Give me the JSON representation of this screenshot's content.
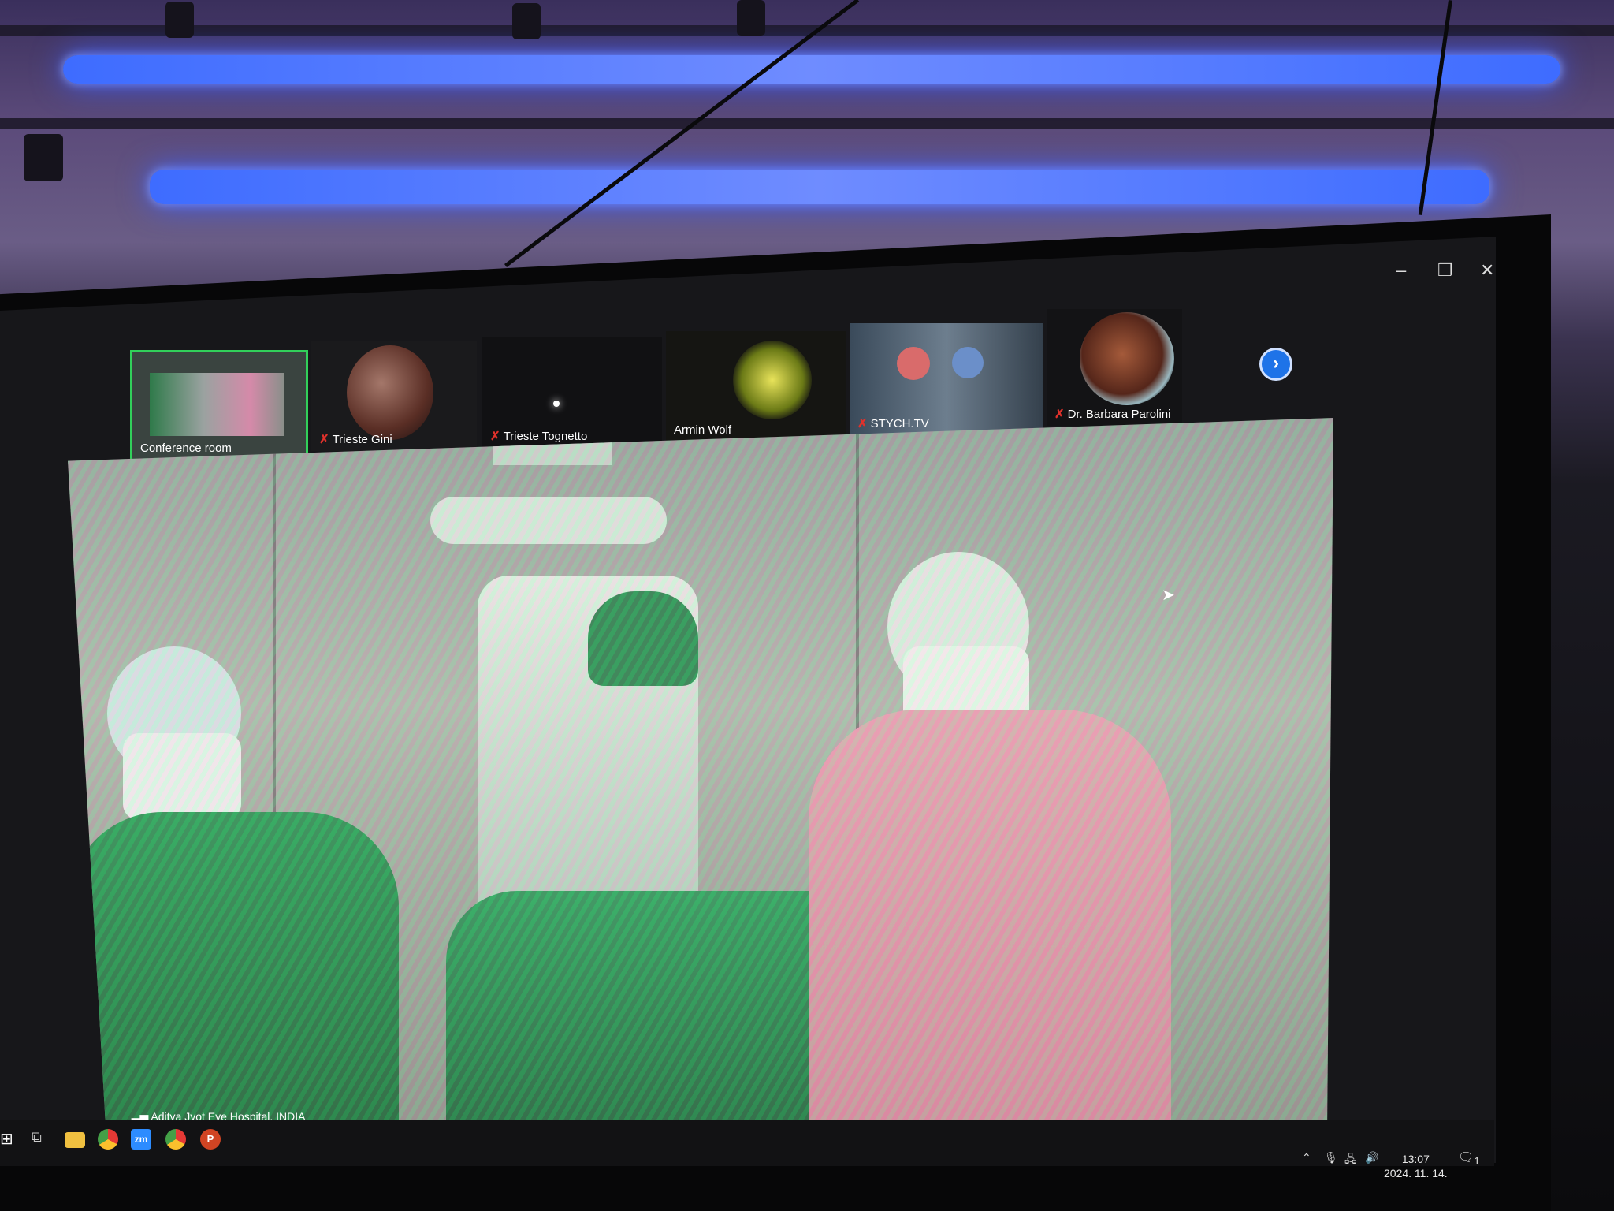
{
  "window": {
    "minimize_icon": "–",
    "restore_icon": "❐",
    "close_icon": "✕"
  },
  "filmstrip": {
    "participants": [
      {
        "name": "Conference room",
        "muted": false,
        "active": true
      },
      {
        "name": "Trieste Gini",
        "muted": true,
        "active": false
      },
      {
        "name": "Trieste Tognetto",
        "muted": true,
        "active": false
      },
      {
        "name": "Armin Wolf",
        "muted": false,
        "active": false
      },
      {
        "name": "STYCH.TV",
        "muted": true,
        "active": false
      },
      {
        "name": "Dr. Barbara Parolini",
        "muted": true,
        "active": false
      }
    ],
    "next_icon": "›"
  },
  "main_video": {
    "speaker_name": "Aditya Jyot Eye Hospital, INDIA"
  },
  "taskbar": {
    "apps": [
      "windows-start",
      "task-view",
      "file-explorer",
      "chrome",
      "zoom",
      "chrome",
      "powerpoint"
    ],
    "zoom_label": "zm",
    "ppt_label": "P",
    "clock_time": "13:07",
    "clock_date": "2024. 11. 14.",
    "notification_count": "1"
  },
  "colors": {
    "active_tile_border": "#31d05a",
    "accent": "#1e73e8",
    "mute": "#e0312b"
  }
}
